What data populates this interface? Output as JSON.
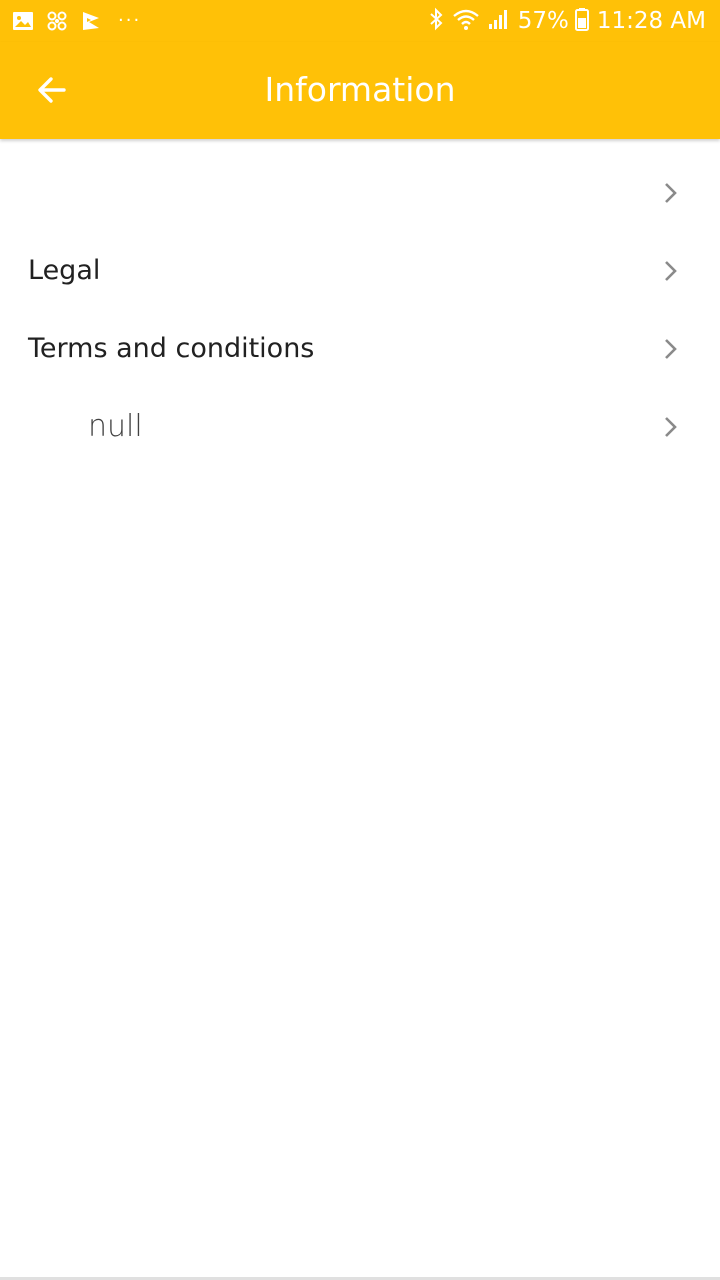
{
  "status_bar": {
    "icons_left": [
      "gallery-icon",
      "fan-icon",
      "flag-icon"
    ],
    "more": "···",
    "icons_right": [
      "bluetooth-icon",
      "wifi-icon",
      "signal-icon"
    ],
    "battery_percent": "57%",
    "time": "11:28 AM",
    "color": "#FFC107"
  },
  "app_bar": {
    "title": "Information",
    "back_icon": "arrow-back-icon",
    "color": "#FFC107"
  },
  "list": {
    "items": [
      {
        "label": "",
        "chevron": "chevron-right-icon"
      },
      {
        "label": "Legal",
        "chevron": "chevron-right-icon"
      },
      {
        "label": "Terms and conditions",
        "chevron": "chevron-right-icon"
      },
      {
        "label": "null",
        "chevron": "chevron-right-icon"
      }
    ]
  }
}
